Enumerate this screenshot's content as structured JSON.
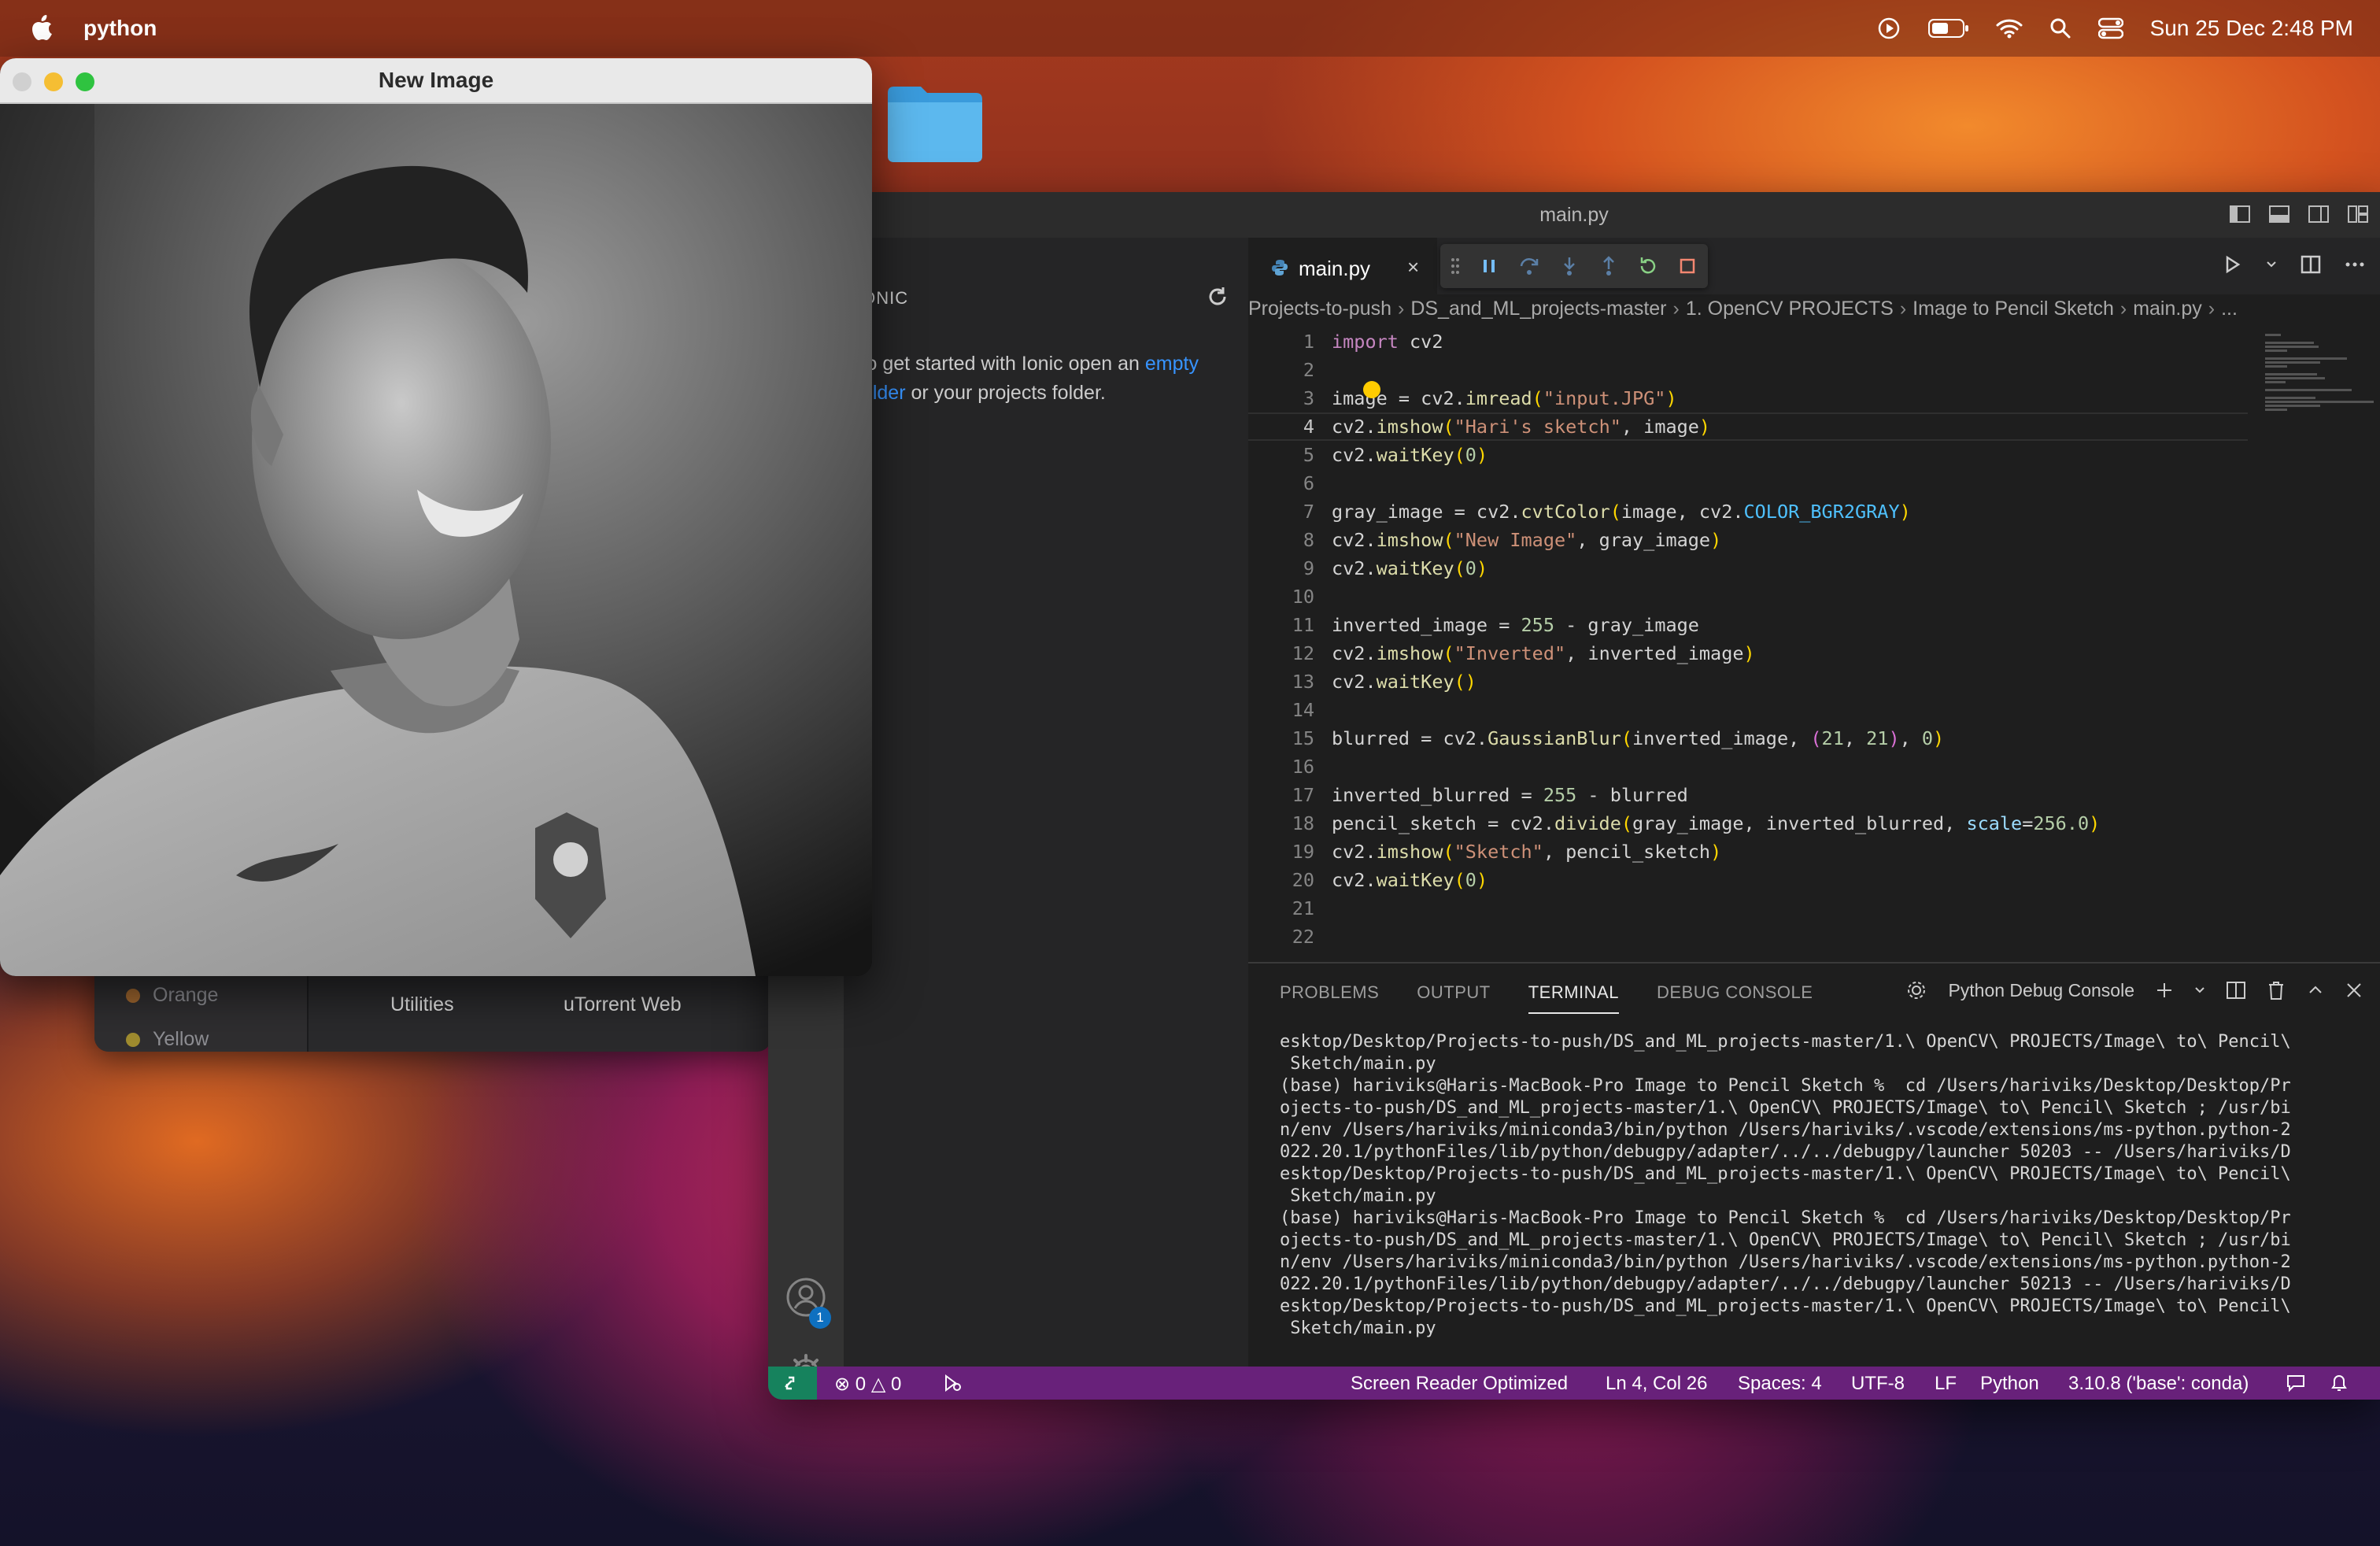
{
  "menubar": {
    "app_name": "python",
    "clock": "Sun 25 Dec  2:48 PM"
  },
  "image_window": {
    "title": "New Image"
  },
  "finder": {
    "tags": [
      "Orange",
      "Yellow"
    ],
    "columns": [
      "Utilities",
      "uTorrent Web"
    ],
    "tag_colors": [
      "#a0672f",
      "#a08c2f"
    ]
  },
  "vscode": {
    "window_title": "main.py",
    "sidebar": {
      "header": "IONIC",
      "message_before": "To get started with Ionic open an ",
      "message_link": "empty folder",
      "message_after": " or your projects folder."
    },
    "accounts_badge": "1",
    "tab": {
      "label": "main.py",
      "close": "×"
    },
    "breadcrumb": [
      "Projects-to-push",
      "DS_and_ML_projects-master",
      "1. OpenCV PROJECTS",
      "Image to Pencil Sketch",
      "main.py",
      "..."
    ],
    "code": [
      "import cv2",
      "",
      "image = cv2.imread(\"input.JPG\")",
      "cv2.imshow(\"Hari's sketch\", image)",
      "cv2.waitKey(0)",
      "",
      "gray_image = cv2.cvtColor(image, cv2.COLOR_BGR2GRAY)",
      "cv2.imshow(\"New Image\", gray_image)",
      "cv2.waitKey(0)",
      "",
      "inverted_image = 255 - gray_image",
      "cv2.imshow(\"Inverted\", inverted_image)",
      "cv2.waitKey()",
      "",
      "blurred = cv2.GaussianBlur(inverted_image, (21, 21), 0)",
      "",
      "inverted_blurred = 255 - blurred",
      "pencil_sketch = cv2.divide(gray_image, inverted_blurred, scale=256.0)",
      "cv2.imshow(\"Sketch\", pencil_sketch)",
      "cv2.waitKey(0)",
      "",
      ""
    ],
    "active_line": 4,
    "panel": {
      "tabs": [
        "PROBLEMS",
        "OUTPUT",
        "TERMINAL",
        "DEBUG CONSOLE"
      ],
      "active_tab": "TERMINAL",
      "terminal_name": "Python Debug Console",
      "terminal_lines": [
        "esktop/Desktop/Projects-to-push/DS_and_ML_projects-master/1.\\ OpenCV\\ PROJECTS/Image\\ to\\ Pencil\\",
        " Sketch/main.py",
        "(base) hariviks@Haris-MacBook-Pro Image to Pencil Sketch %  cd /Users/hariviks/Desktop/Desktop/Pr",
        "ojects-to-push/DS_and_ML_projects-master/1.\\ OpenCV\\ PROJECTS/Image\\ to\\ Pencil\\ Sketch ; /usr/bi",
        "n/env /Users/hariviks/miniconda3/bin/python /Users/hariviks/.vscode/extensions/ms-python.python-2",
        "022.20.1/pythonFiles/lib/python/debugpy/adapter/../../debugpy/launcher 50203 -- /Users/hariviks/D",
        "esktop/Desktop/Projects-to-push/DS_and_ML_projects-master/1.\\ OpenCV\\ PROJECTS/Image\\ to\\ Pencil\\",
        " Sketch/main.py",
        "(base) hariviks@Haris-MacBook-Pro Image to Pencil Sketch %  cd /Users/hariviks/Desktop/Desktop/Pr",
        "ojects-to-push/DS_and_ML_projects-master/1.\\ OpenCV\\ PROJECTS/Image\\ to\\ Pencil\\ Sketch ; /usr/bi",
        "n/env /Users/hariviks/miniconda3/bin/python /Users/hariviks/.vscode/extensions/ms-python.python-2",
        "022.20.1/pythonFiles/lib/python/debugpy/adapter/../../debugpy/launcher 50213 -- /Users/hariviks/D",
        "esktop/Desktop/Projects-to-push/DS_and_ML_projects-master/1.\\ OpenCV\\ PROJECTS/Image\\ to\\ Pencil\\",
        " Sketch/main.py"
      ]
    },
    "statusbar": {
      "errors": "0",
      "warnings": "0",
      "screen_reader": "Screen Reader Optimized",
      "position": "Ln 4, Col 26",
      "spaces": "Spaces: 4",
      "encoding": "UTF-8",
      "eol": "LF",
      "language": "Python",
      "interpreter": "3.10.8 ('base': conda)",
      "color": "#68217a",
      "remote_color": "#16825d"
    }
  }
}
